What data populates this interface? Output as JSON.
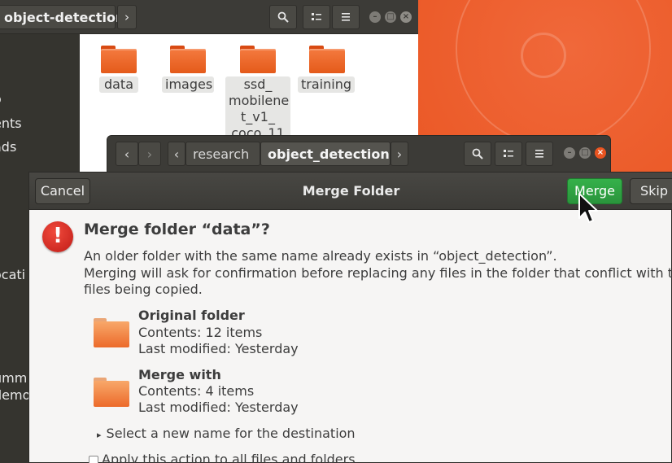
{
  "back_window": {
    "path_label": "object-detection",
    "chevron": "›",
    "search_icon": "search-icon",
    "view_icon": "view-list-icon",
    "menu_icon": "hamburger-menu-icon",
    "sidebar_fragments": [
      "o",
      "ents",
      "ads",
      "s",
      "ocati",
      "umm",
      "demo"
    ],
    "folders": [
      {
        "name": "data"
      },
      {
        "name": "images"
      },
      {
        "name_lines": [
          "ssd_",
          "mobilene",
          "t_v1_",
          "coco_11"
        ]
      },
      {
        "name": "training"
      }
    ]
  },
  "middle_window": {
    "back_glyph": "‹",
    "forward_glyph": "›",
    "left_arrow": "‹",
    "crumb_parent": "research",
    "crumb_current": "object_detection",
    "right_arrow": "›"
  },
  "dialog": {
    "cancel_label": "Cancel",
    "title": "Merge Folder",
    "merge_label": "Merge",
    "skip_label": "Skip",
    "heading": "Merge folder “data”?",
    "line1": "An older folder with the same name already exists in “object_detection”.",
    "line2": "Merging will ask for confirmation before replacing any files in the folder that conflict with the",
    "line3": "files being copied.",
    "original": {
      "title": "Original folder",
      "contents": "Contents: 12 items",
      "modified": "Last modified: Yesterday"
    },
    "merge_with": {
      "title": "Merge with",
      "contents": "Contents: 4 items",
      "modified": "Last modified: Yesterday"
    },
    "expander_arrow": "▸",
    "expander_label": "Select a new name for the destination",
    "apply_all_label": "Apply this action to all files and folders"
  },
  "colors": {
    "accent": "#e95420",
    "merge_green": "#2fa443",
    "header_dark": "#3c3b37"
  }
}
